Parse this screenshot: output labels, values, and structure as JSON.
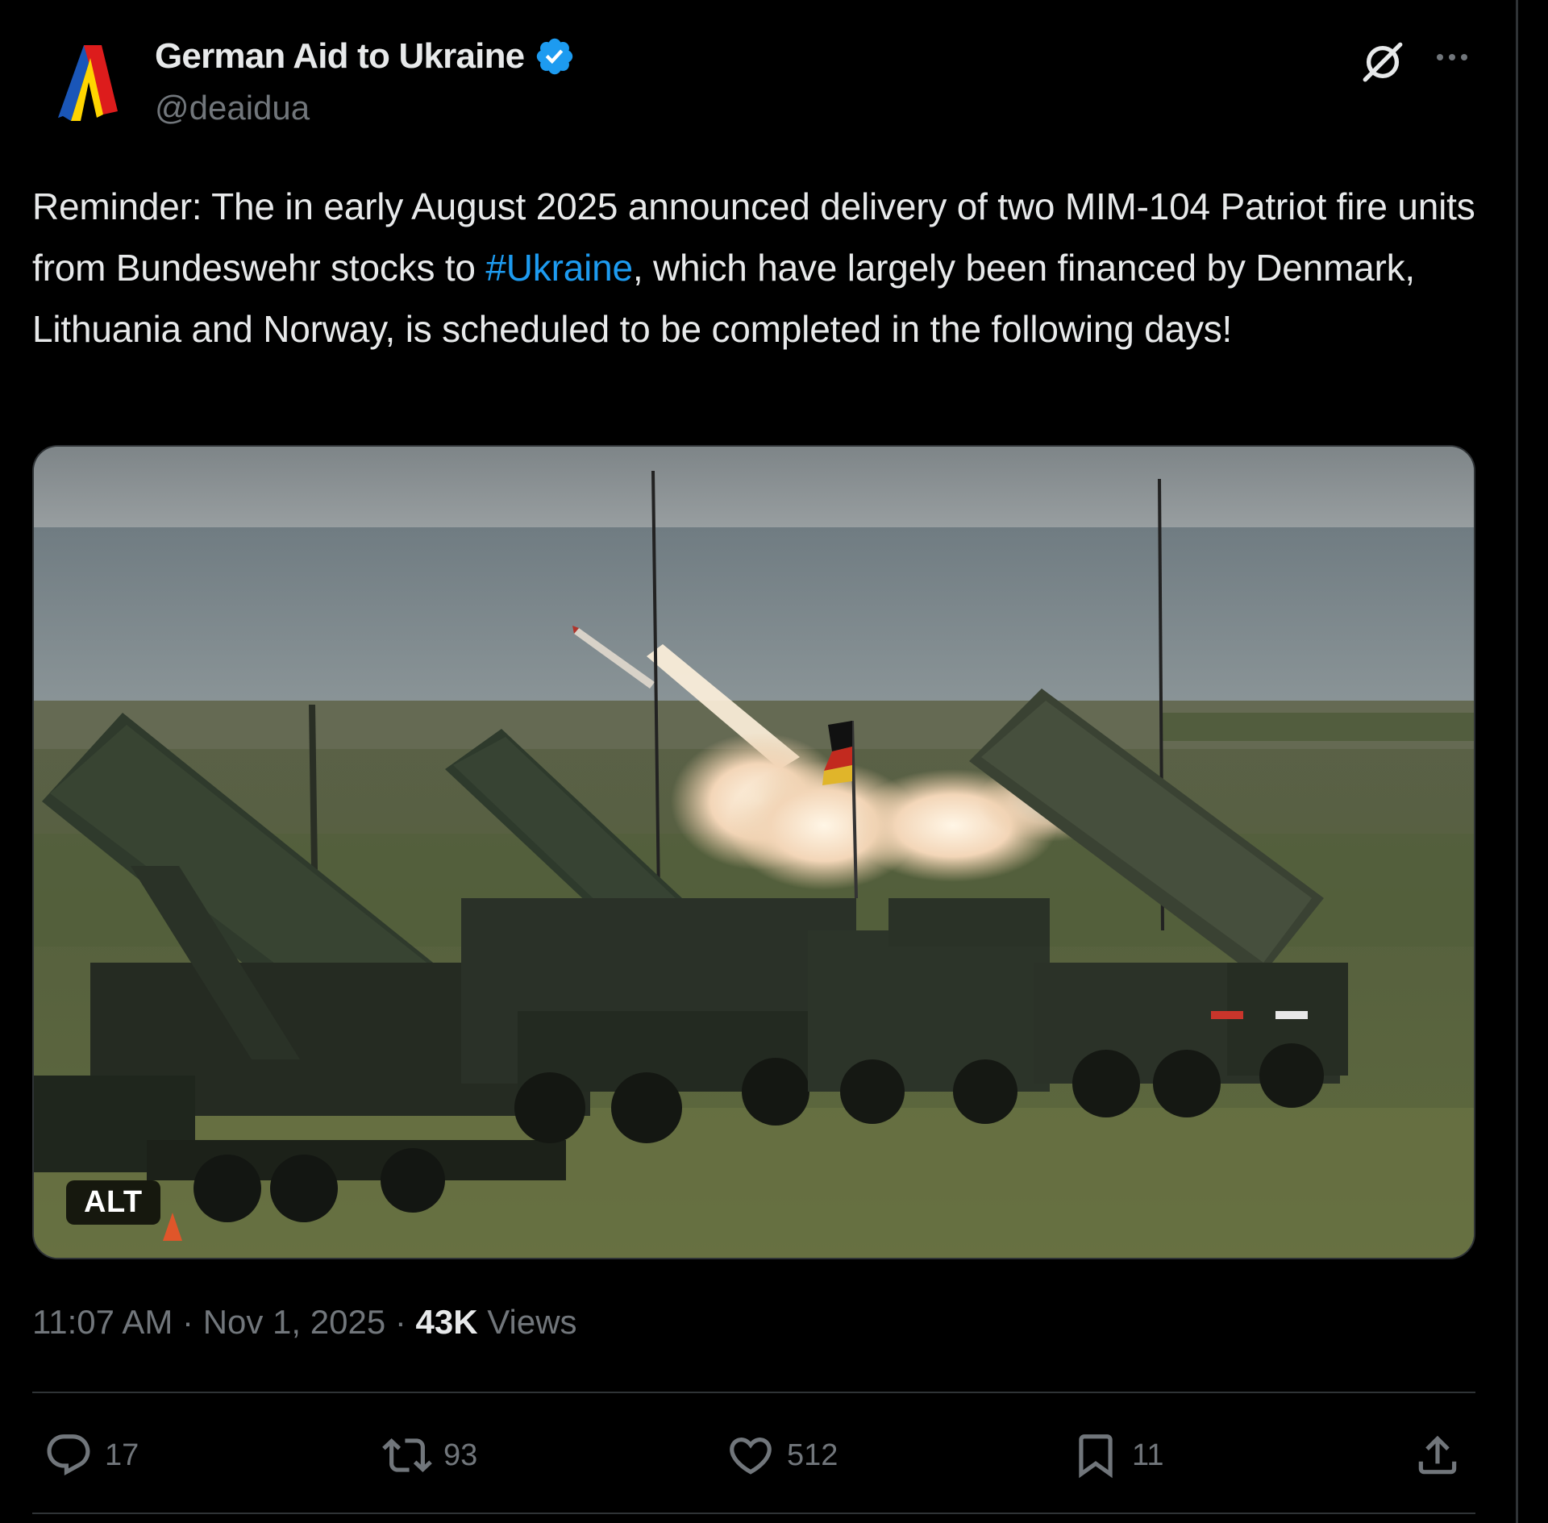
{
  "post": {
    "author": {
      "display_name": "German Aid to Ukraine",
      "handle": "@deaidua",
      "verified": true
    },
    "text": {
      "before_hashtag": "Reminder: The in early August 2025 announced delivery of two MIM-104 Patriot fire units from Bundeswehr stocks to ",
      "hashtag": "#Ukraine",
      "after_hashtag": ", which have largely been financed by Denmark, Lithuania and Norway, is scheduled to be completed in the following days!"
    },
    "media": {
      "alt_badge": "ALT"
    },
    "meta": {
      "time": "11:07 AM",
      "separator": "·",
      "date": "Nov 1, 2025",
      "views_count": "43K",
      "views_label": "Views"
    },
    "actions": {
      "replies": "17",
      "reposts": "93",
      "likes": "512",
      "bookmarks": "11"
    }
  },
  "icons": {
    "verified": "verified-badge-icon",
    "grok": "grok-icon",
    "more": "more-icon",
    "reply": "reply-icon",
    "repost": "repost-icon",
    "like": "heart-icon",
    "bookmark": "bookmark-icon",
    "share": "share-icon"
  },
  "colors": {
    "background": "#000000",
    "text_primary": "#e7e9ea",
    "text_secondary": "#71767b",
    "link": "#1d9bf0",
    "verified": "#1d9bf0",
    "border": "#2f3336",
    "logo_blue": "#1a56b8",
    "logo_yellow": "#ffd500",
    "logo_red": "#dd1c1c"
  }
}
